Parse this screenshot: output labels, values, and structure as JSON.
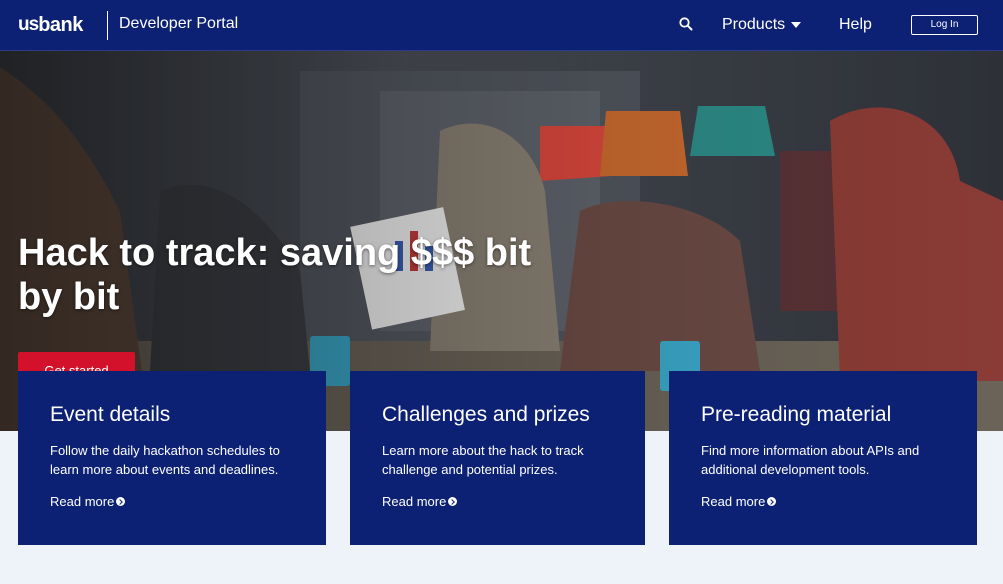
{
  "header": {
    "logo_text_us": "us",
    "logo_text_bank": "bank",
    "portal_title": "Developer Portal",
    "nav": {
      "products": "Products",
      "help": "Help",
      "login": "Log In"
    }
  },
  "hero": {
    "title": "Hack to track: saving $$$ bit by bit",
    "cta": "Get started"
  },
  "cards": [
    {
      "title": "Event details",
      "description": "Follow the daily hackathon schedules to learn more about events and deadlines.",
      "link": "Read more"
    },
    {
      "title": "Challenges and prizes",
      "description": "Learn more about the hack to track challenge and potential prizes.",
      "link": "Read more"
    },
    {
      "title": "Pre-reading material",
      "description": "Find more information about APIs and additional development tools.",
      "link": "Read more"
    }
  ],
  "colors": {
    "brand_navy": "#0c2074",
    "cta_red": "#d4112b",
    "page_bg": "#eef3f9"
  }
}
